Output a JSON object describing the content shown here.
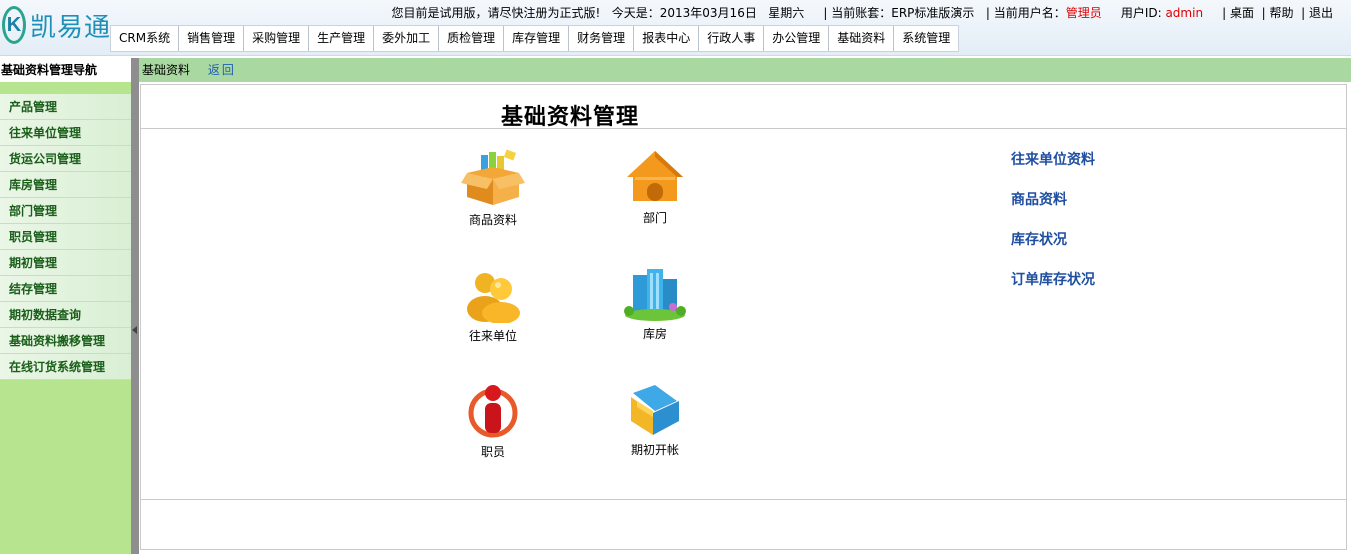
{
  "app": {
    "logo_letter": "K",
    "logo_text": "凯易通"
  },
  "topinfo": {
    "trial_notice": "您目前是试用版，请尽快注册为正式版!",
    "date_label": "今天是：2013年03月16日",
    "weekday": "星期六",
    "account_label": "| 当前账套：ERP标准版演示",
    "user_label": "| 当前用户名：",
    "user_name": "管理员",
    "userid_label": "用户ID: ",
    "userid": "admin",
    "desktop_link": "| 桌面",
    "help_link": "| 帮助",
    "logout_link": "| 退出"
  },
  "nav_tabs": [
    "CRM系统",
    "销售管理",
    "采购管理",
    "生产管理",
    "委外加工",
    "质检管理",
    "库存管理",
    "财务管理",
    "报表中心",
    "行政人事",
    "办公管理",
    "基础资料",
    "系统管理"
  ],
  "sidebar": {
    "title": "基础资料管理导航",
    "items": [
      "产品管理",
      "往来单位管理",
      "货运公司管理",
      "库房管理",
      "部门管理",
      "职员管理",
      "期初管理",
      "结存管理",
      "期初数据查询",
      "基础资料搬移管理",
      "在线订货系统管理"
    ]
  },
  "breadcrumb": {
    "current": "基础资料",
    "back": "返回"
  },
  "main": {
    "title": "基础资料管理",
    "modules": [
      {
        "label": "商品资料",
        "icon": "box-products-icon"
      },
      {
        "label": "部门",
        "icon": "house-icon"
      },
      {
        "label": "往来单位",
        "icon": "users-icon"
      },
      {
        "label": "库房",
        "icon": "buildings-icon"
      },
      {
        "label": "职员",
        "icon": "person-icon"
      },
      {
        "label": "期初开帐",
        "icon": "folder-icon"
      }
    ],
    "quick_links": [
      "往来单位资料",
      "商品资料",
      "库存状况",
      "订单库存状况"
    ]
  },
  "colors": {
    "sidebar_bg": "#b7e58f",
    "crumb_bg": "#a9d8a0",
    "link_blue": "#1f4fa0",
    "accent_red": "#e00000"
  }
}
